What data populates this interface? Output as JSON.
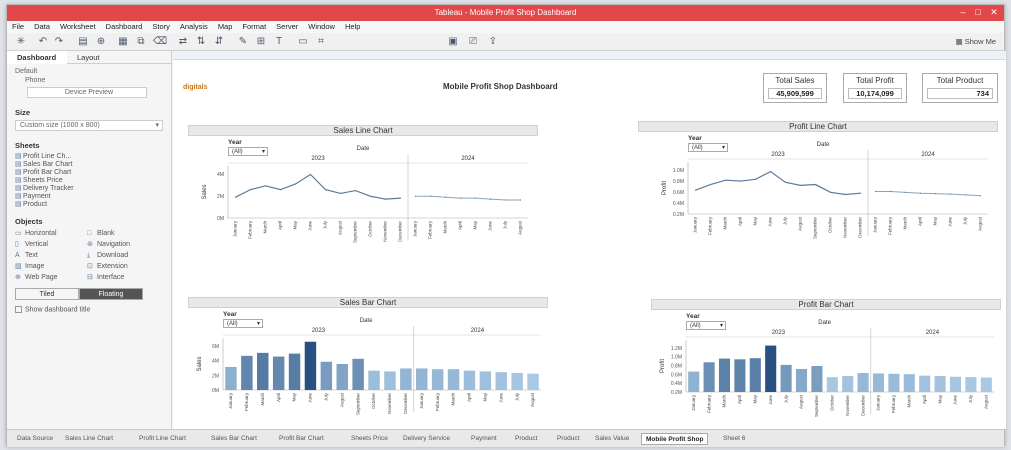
{
  "window": {
    "title": "Tableau - Mobile Profit Shop Dashboard"
  },
  "menu": [
    "File",
    "Data",
    "Worksheet",
    "Dashboard",
    "Story",
    "Analysis",
    "Map",
    "Format",
    "Server",
    "Window",
    "Help"
  ],
  "toolbar": {
    "show_me": "Show Me"
  },
  "sidebar": {
    "tabs": [
      "Dashboard",
      "Layout"
    ],
    "device_preview": {
      "default": "Default",
      "phone": "Phone",
      "button": "Device Preview"
    },
    "size_header": "Size",
    "size_value": "Custom size (1000 x 800)",
    "sheets_header": "Sheets",
    "sheets": [
      "Profit Line Ch...",
      "Sales Bar Chart",
      "Profit Bar Chart",
      "Sheets Price",
      "Delivery Tracker",
      "Payment",
      "Product"
    ],
    "objects_header": "Objects",
    "objects": [
      "Horizontal",
      "Blank",
      "Vertical",
      "Navigation",
      "Text",
      "Download",
      "Image",
      "Extension",
      "Web Page",
      "Interface"
    ],
    "tiled": "Tiled",
    "floating": "Floating",
    "show_title": "Show dashboard title"
  },
  "dashboard": {
    "logo": "digitals",
    "title": "Mobile Profit Shop Dashboard",
    "kpis": [
      {
        "title": "Total Sales",
        "value": "45,909,599"
      },
      {
        "title": "Total Profit",
        "value": "10,174,099"
      },
      {
        "title": "Total Product",
        "value": "734"
      }
    ]
  },
  "charts": [
    {
      "title": "Sales Line Chart",
      "year_label": "Year",
      "year_value": "(All)",
      "date_header": "Date",
      "sub_headers": [
        "2023",
        "2024"
      ],
      "y_axis_title": "Sales"
    },
    {
      "title": "Profit Line Chart",
      "year_label": "Year",
      "year_value": "(All)",
      "date_header": "Date",
      "sub_headers": [
        "2023",
        "2024"
      ],
      "y_axis_title": "Profit"
    },
    {
      "title": "Sales Bar Chart",
      "year_label": "Year",
      "year_value": "(All)",
      "date_header": "Date",
      "sub_headers": [
        "2023",
        "2024"
      ],
      "y_axis_title": "Sales"
    },
    {
      "title": "Profit Bar Chart",
      "year_label": "Year",
      "year_value": "(All)",
      "date_header": "Date",
      "sub_headers": [
        "2023",
        "2024"
      ],
      "y_axis_title": "Profit"
    }
  ],
  "chart_data": [
    {
      "type": "line",
      "title": "Sales Line Chart",
      "ylabel": "Sales",
      "categories": [
        "January",
        "February",
        "March",
        "April",
        "May",
        "June",
        "July",
        "August",
        "September",
        "October",
        "November",
        "December",
        "January",
        "February",
        "March",
        "April",
        "May",
        "June",
        "July",
        "August"
      ],
      "series": [
        {
          "values": [
            2.2,
            3.0,
            3.4,
            3.0,
            3.6,
            4.6,
            3.0,
            2.6,
            2.9,
            2.3,
            2.0,
            2.1,
            2.3,
            2.3,
            2.2,
            2.1,
            2.1,
            2.0,
            1.9,
            1.9
          ]
        }
      ],
      "ylim": [
        0,
        5.5
      ],
      "yticks": [
        "4M",
        "2M",
        "0M"
      ]
    },
    {
      "type": "line",
      "title": "Profit Line Chart",
      "ylabel": "Profit",
      "categories": [
        "January",
        "February",
        "March",
        "April",
        "May",
        "June",
        "July",
        "August",
        "September",
        "October",
        "November",
        "December",
        "January",
        "February",
        "March",
        "April",
        "May",
        "June",
        "July",
        "August"
      ],
      "series": [
        {
          "values": [
            0.55,
            0.68,
            0.78,
            0.76,
            0.8,
            0.98,
            0.73,
            0.66,
            0.68,
            0.5,
            0.45,
            0.48,
            0.52,
            0.52,
            0.5,
            0.48,
            0.47,
            0.46,
            0.44,
            0.42
          ]
        }
      ],
      "ylim": [
        0,
        1.2
      ],
      "yticks": [
        "1.0M",
        "0.8M",
        "0.6M",
        "0.4M",
        "0.2M"
      ]
    },
    {
      "type": "bar",
      "title": "Sales Bar Chart",
      "ylabel": "Sales",
      "categories": [
        "January",
        "February",
        "March",
        "April",
        "May",
        "June",
        "July",
        "August",
        "September",
        "October",
        "November",
        "December",
        "January",
        "February",
        "March",
        "April",
        "May",
        "June",
        "July",
        "August"
      ],
      "values": [
        3.1,
        4.6,
        5.0,
        4.5,
        4.9,
        6.5,
        3.8,
        3.5,
        4.2,
        2.6,
        2.5,
        2.9,
        2.9,
        2.8,
        2.8,
        2.6,
        2.5,
        2.4,
        2.3,
        2.2
      ],
      "ylim": [
        0,
        7
      ],
      "yticks": [
        "6M",
        "4M",
        "2M",
        "0M"
      ]
    },
    {
      "type": "bar",
      "title": "Profit Bar Chart",
      "ylabel": "Profit",
      "categories": [
        "January",
        "February",
        "March",
        "April",
        "May",
        "June",
        "July",
        "August",
        "September",
        "October",
        "November",
        "December",
        "January",
        "February",
        "March",
        "April",
        "May",
        "June",
        "July",
        "August"
      ],
      "values": [
        0.55,
        0.8,
        0.9,
        0.88,
        0.91,
        1.25,
        0.73,
        0.62,
        0.7,
        0.4,
        0.43,
        0.51,
        0.5,
        0.49,
        0.48,
        0.44,
        0.43,
        0.41,
        0.4,
        0.39
      ],
      "ylim": [
        0,
        1.4
      ],
      "yticks": [
        "1.2M",
        "1.0M",
        "0.8M",
        "0.6M",
        "0.4M",
        "0.2M"
      ]
    }
  ],
  "sheet_tabs": [
    "Data Source",
    "Sales Line Chart",
    "Profit Line Chart",
    "Sales Bar Chart",
    "Profit Bar Chart",
    "Sheets Price",
    "Delivery Service",
    "Payment",
    "Product",
    "Product",
    "Sales Value",
    "Mobile Profit Shop",
    "Sheet 6"
  ],
  "colors": {
    "title_bar": "#e2484a",
    "bar_dark": "#2e5a88",
    "bar_light": "#a8c8e4",
    "line": "#5b7a9a"
  }
}
